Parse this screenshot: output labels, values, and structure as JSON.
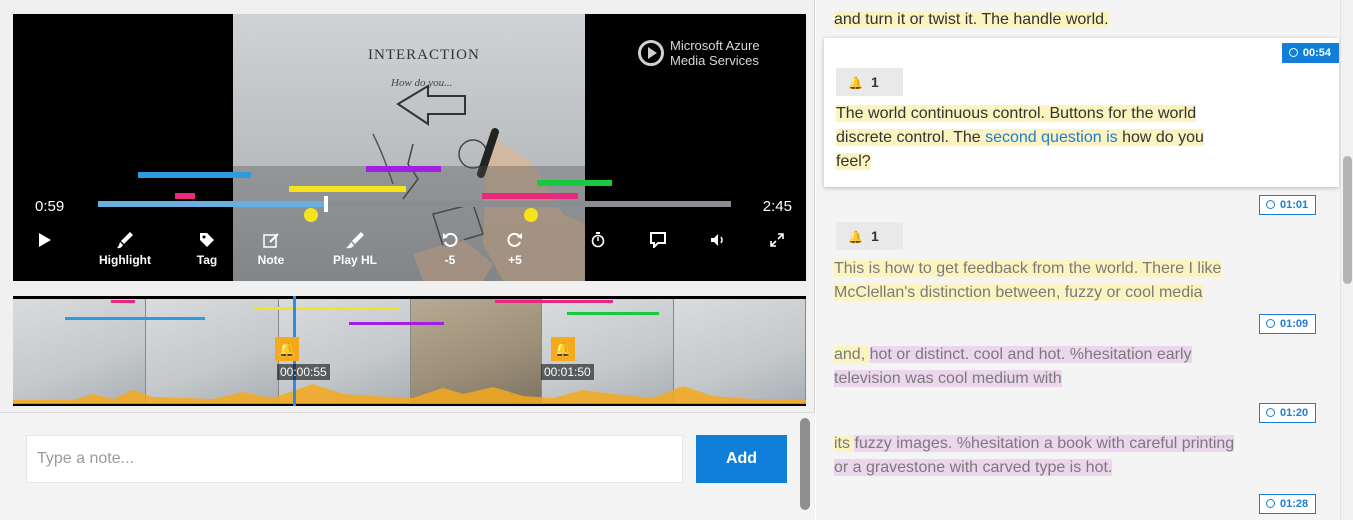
{
  "player": {
    "brand_line1": "Microsoft Azure",
    "brand_line2": "Media Services",
    "whiteboard_title": "INTERACTION",
    "whiteboard_sub": "How do you...",
    "current_time": "0:59",
    "duration": "2:45",
    "progress": 0.36,
    "controls": {
      "highlight": "Highlight",
      "tag": "Tag",
      "note": "Note",
      "play_hl": "Play HL",
      "back": "-5",
      "forward": "+5"
    },
    "highlight_colors": {
      "blue": "#2e9be0",
      "pink": "#e8297f",
      "yellow": "#f5e31b",
      "purple": "#a31ee0",
      "green": "#17c93c"
    }
  },
  "strip": {
    "markers": [
      {
        "time": "00:00:55"
      },
      {
        "time": "00:01:50"
      }
    ]
  },
  "note": {
    "placeholder": "Type a note...",
    "add_label": "Add"
  },
  "transcript": {
    "top_line": "and turn it or twist it. The handle world.",
    "active": {
      "time": "00:54",
      "badge_count": "1",
      "line1": "The world continuous control. Buttons for the world",
      "line2_a": "discrete control. The ",
      "line2_b": "second question is",
      "line2_c": " how do you",
      "line3": "feel?"
    },
    "entries": [
      {
        "time": "01:01"
      },
      {
        "time": "01:09"
      },
      {
        "time": "01:20"
      },
      {
        "time": "01:28"
      }
    ],
    "block2_badge": "1",
    "block2_line1": "This is how to get feedback from the world. There I like",
    "block2_line2": "McClellan's distinction between, fuzzy or cool media",
    "block3_a": "and, ",
    "block3_b": "hot or distinct. cool and hot. %hesitation early",
    "block3_line2": "television was cool medium with",
    "block4_a": "its ",
    "block4_b": "fuzzy images. %hesitation a book with careful printing",
    "block4_line2": "or a gravestone with carved type is hot."
  }
}
